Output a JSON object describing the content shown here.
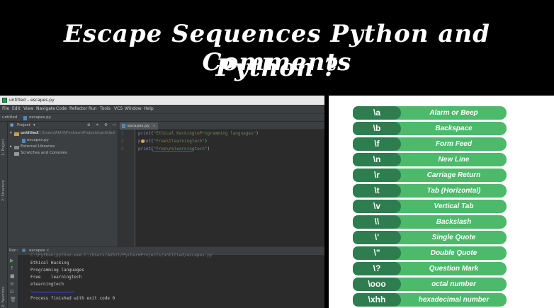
{
  "title": {
    "line1": "Escape Sequences Python and Comments",
    "line2": "Python ?"
  },
  "ide": {
    "window_title": "untitled – escapes.py",
    "menu": [
      "File",
      "Edit",
      "View",
      "Navigate",
      "Code",
      "Refactor",
      "Run",
      "Tools",
      "VCS",
      "Window",
      "Help"
    ],
    "breadcrumb": [
      "untitled",
      "escapes.py"
    ],
    "project_panel": {
      "header": "Project",
      "root_name": "untitled",
      "root_path": "C:\\Users\\Akhil\\PycharmProjects\\untitled",
      "file": "escapes.py",
      "external": "External Libraries",
      "scratches": "Scratches and Consoles"
    },
    "side_tabs": [
      "1: Project",
      "2: Structure",
      "2: Favorites"
    ],
    "editor_tab": "escapes.py",
    "code_lines": [
      {
        "n": "1",
        "fn": "print",
        "pre": "(",
        "s1": "\"Ethical Hacking",
        "esc": "\\n",
        "s2": "Programming languages\"",
        "post": ")"
      },
      {
        "n": "2",
        "fn": "print",
        "pre": "(",
        "s1": "\"Free",
        "esc": "\\t",
        "s2": "learningtech\"",
        "post": ")"
      },
      {
        "n": "3",
        "fn": "print",
        "pre": "(",
        "s1": "\"Free",
        "esc": "\\r",
        "s2": "elearningtech\"",
        "post": ")"
      }
    ],
    "run_panel": {
      "label": "Run:",
      "config": "escapes",
      "cut_line": "C:\\Python\\python.exe C:/Users/Akhil/PycharmProjects/untitled/escapes.py",
      "output": [
        "Ethical Hacking",
        "Programming languages",
        "Free    learningtech",
        "elearningtech",
        "",
        "Process finished with exit code 0"
      ]
    }
  },
  "escape_table": [
    {
      "seq": "\\a",
      "desc": "Alarm or Beep"
    },
    {
      "seq": "\\b",
      "desc": "Backspace"
    },
    {
      "seq": "\\f",
      "desc": "Form Feed"
    },
    {
      "seq": "\\n",
      "desc": "New Line"
    },
    {
      "seq": "\\r",
      "desc": "Carriage Return"
    },
    {
      "seq": "\\t",
      "desc": "Tab (Horizontal)"
    },
    {
      "seq": "\\v",
      "desc": "Vertical Tab"
    },
    {
      "seq": "\\\\",
      "desc": "Backslash"
    },
    {
      "seq": "\\'",
      "desc": "Single Quote"
    },
    {
      "seq": "\\\"",
      "desc": "Double Quote"
    },
    {
      "seq": "\\?",
      "desc": "Question Mark"
    },
    {
      "seq": "\\ooo",
      "desc": "octal number"
    },
    {
      "seq": "\\xhh",
      "desc": "hexadecimal number"
    }
  ],
  "colors": {
    "banner_bg": "#000000",
    "row_green": "#4cb96b",
    "seq_green": "#2e7d4f",
    "ide_bg": "#2b2b2b"
  }
}
